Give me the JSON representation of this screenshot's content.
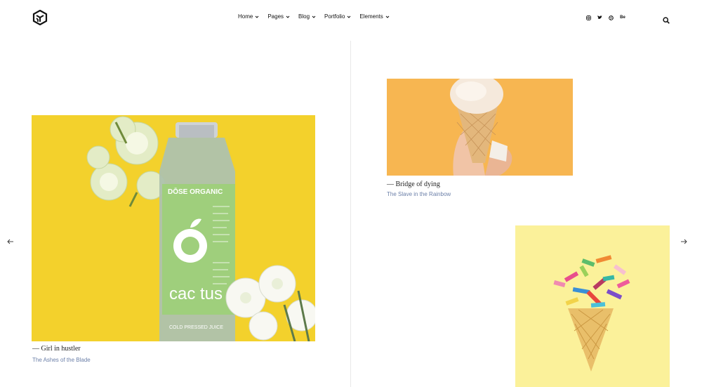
{
  "header": {
    "nav": [
      {
        "label": "Home"
      },
      {
        "label": "Pages"
      },
      {
        "label": "Blog"
      },
      {
        "label": "Portfolio"
      },
      {
        "label": "Elements"
      }
    ],
    "socials": [
      {
        "icon": "instagram-icon"
      },
      {
        "icon": "twitter-icon"
      },
      {
        "icon": "dribbble-icon"
      },
      {
        "icon": "behance-icon",
        "label": "Be"
      }
    ]
  },
  "portfolio": {
    "items": [
      {
        "title": "— Girl in hustler",
        "subtitle": "The Ashes of the Blade",
        "bottle": {
          "brand": "DŌSE ORGANIC",
          "product": "cac tus",
          "tagline": "COLD PRESSED JUICE"
        }
      },
      {
        "title": "— Bridge of dying",
        "subtitle": "The Slave in the Rainbow"
      },
      {
        "title": "",
        "subtitle": ""
      }
    ]
  },
  "colors": {
    "yellow_bg": "#f3d12c",
    "orange_bg": "#f7b651",
    "pale_yellow_bg": "#fbf19a",
    "subtitle": "#6b7fa8"
  }
}
